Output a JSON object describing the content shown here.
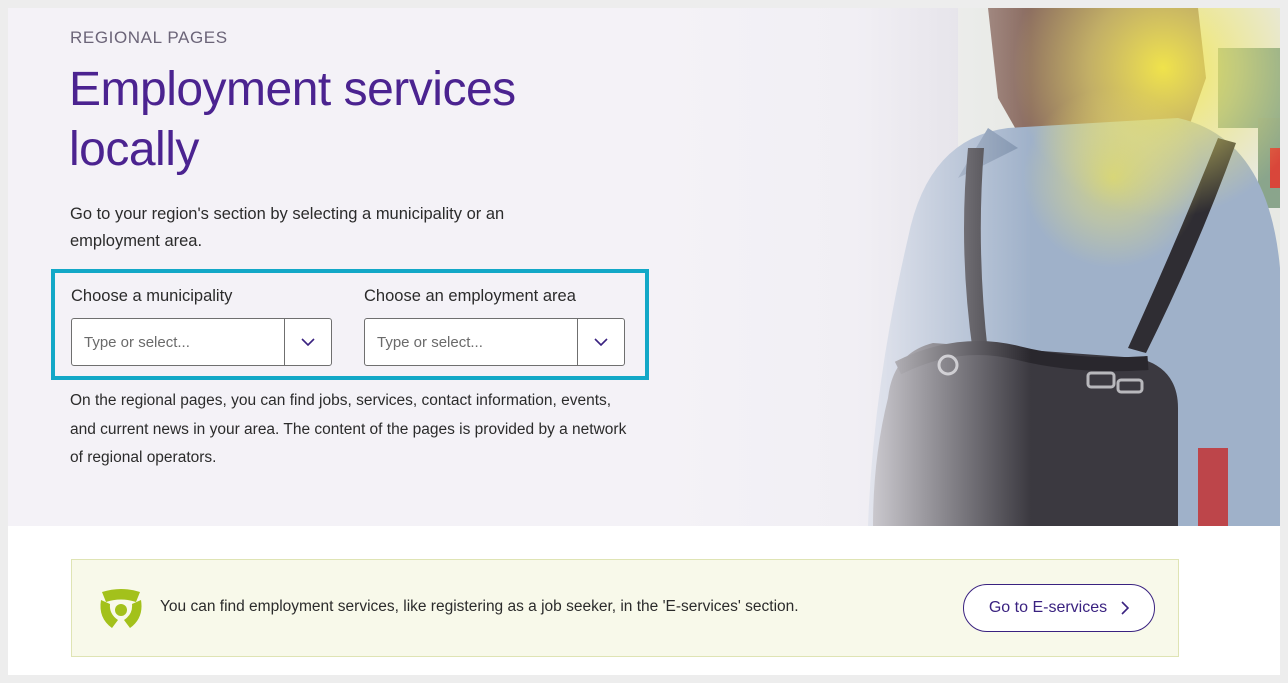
{
  "hero": {
    "eyebrow": "REGIONAL PAGES",
    "title": "Employment services locally",
    "intro": "Go to your region's section by selecting a municipality or an employment area.",
    "description": "On the regional pages, you can find jobs, services, contact information, events, and current news in your area. The content of the pages is provided by a network of regional operators."
  },
  "selectors": {
    "municipality": {
      "label": "Choose a municipality",
      "placeholder": "Type or select...",
      "value": ""
    },
    "employment_area": {
      "label": "Choose an employment area",
      "placeholder": "Type or select...",
      "value": ""
    }
  },
  "notice": {
    "message": "You can find employment services, like registering as a job seeker, in the 'E-services' section.",
    "button_label": "Go to E-services"
  },
  "colors": {
    "title": "#4b2390",
    "highlight_border": "#12a8c7",
    "notice_bg": "#f8f9ea",
    "logo": "#a3c11b",
    "button_border": "#3a2280"
  },
  "icons": {
    "dropdown": "chevron-down-icon",
    "button": "chevron-right-icon",
    "logo": "services-logo-icon"
  }
}
